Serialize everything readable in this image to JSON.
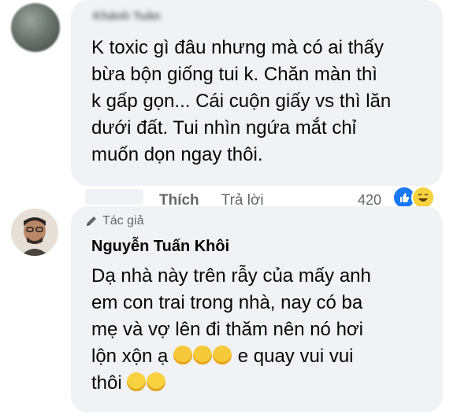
{
  "comment_1": {
    "author_name": "Khánh Tuân",
    "text": "K toxic gì đâu nhưng mà có ai thấy\nbừa bộn giống tui k. Chăn màn thì\nk gấp gọn... Cái cuộn giấy vs thì lăn\ndưới đất. Tui nhìn ngứa mắt chỉ\nmuốn dọn ngay thôi."
  },
  "actions": {
    "like_label": "Thích",
    "reply_label": "Trả lời",
    "reaction_count": "420",
    "reaction_icons": [
      "like-icon",
      "haha-icon"
    ]
  },
  "comment_2": {
    "badge_label": "Tác giả",
    "badge_icon": "pen-icon",
    "author_name": "Nguyễn Tuấn Khôi",
    "text_main": "Dạ nhà này trên rẫy của mấy anh\nem con trai trong nhà, nay có ba\nmẹ và vợ lên đi thăm nên nó hơi\nlộn xộn ạ ",
    "text_mid": " e quay vui vui\nthôi ",
    "emojis_1": [
      "smiling-face-with-hearts",
      "smiling-face-with-hearts",
      "smiling-face-with-hearts"
    ],
    "emojis_2": [
      "grinning-sweat",
      "grinning-face"
    ]
  },
  "colors": {
    "bubble_bg": "#f0f2f5",
    "secondary_text": "#65676b",
    "like_blue": "#1877f2"
  }
}
